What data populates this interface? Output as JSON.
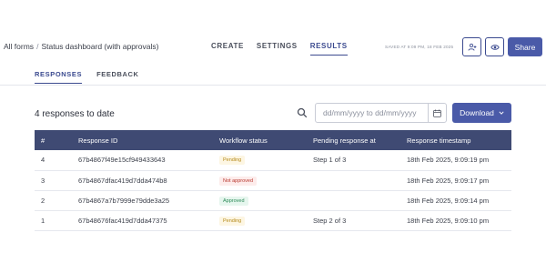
{
  "breadcrumb": {
    "root": "All forms",
    "separator": "/",
    "current": "Status dashboard (with approvals)"
  },
  "main_tabs": [
    {
      "label": "CREATE",
      "active": false
    },
    {
      "label": "SETTINGS",
      "active": false
    },
    {
      "label": "RESULTS",
      "active": true
    }
  ],
  "saved_text": "SAVED AT 9:09 PM, 18 FEB 2025",
  "icons": {
    "collaborators": "add-user-icon",
    "preview": "eye-icon"
  },
  "share_label": "Share",
  "sub_tabs": [
    {
      "label": "RESPONSES",
      "active": true
    },
    {
      "label": "FEEDBACK",
      "active": false
    }
  ],
  "results": {
    "count_text": "4 responses to date",
    "date_range_placeholder": "dd/mm/yyyy  to  dd/mm/yyyy",
    "download_label": "Download"
  },
  "table": {
    "headers": [
      "#",
      "Response ID",
      "Workflow status",
      "Pending response at",
      "Response timestamp"
    ],
    "rows": [
      {
        "num": "4",
        "id": "67b4867f49e15cf949433643",
        "status": "Pending",
        "status_type": "pending",
        "pending_at": "Step 1 of 3",
        "timestamp": "18th Feb 2025, 9:09:19 pm"
      },
      {
        "num": "3",
        "id": "67b4867dfac419d7dda474b8",
        "status": "Not approved",
        "status_type": "rejected",
        "pending_at": "",
        "timestamp": "18th Feb 2025, 9:09:17 pm"
      },
      {
        "num": "2",
        "id": "67b4867a7b7999e79dde3a25",
        "status": "Approved",
        "status_type": "approved",
        "pending_at": "",
        "timestamp": "18th Feb 2025, 9:09:14 pm"
      },
      {
        "num": "1",
        "id": "67b48676fac419d7dda47375",
        "status": "Pending",
        "status_type": "pending",
        "pending_at": "Step 2 of 3",
        "timestamp": "18th Feb 2025, 9:09:10 pm"
      }
    ]
  },
  "colors": {
    "accent": "#4a5aa8",
    "header_bg": "#3f4a73",
    "active_tab": "#3b4a8f"
  }
}
